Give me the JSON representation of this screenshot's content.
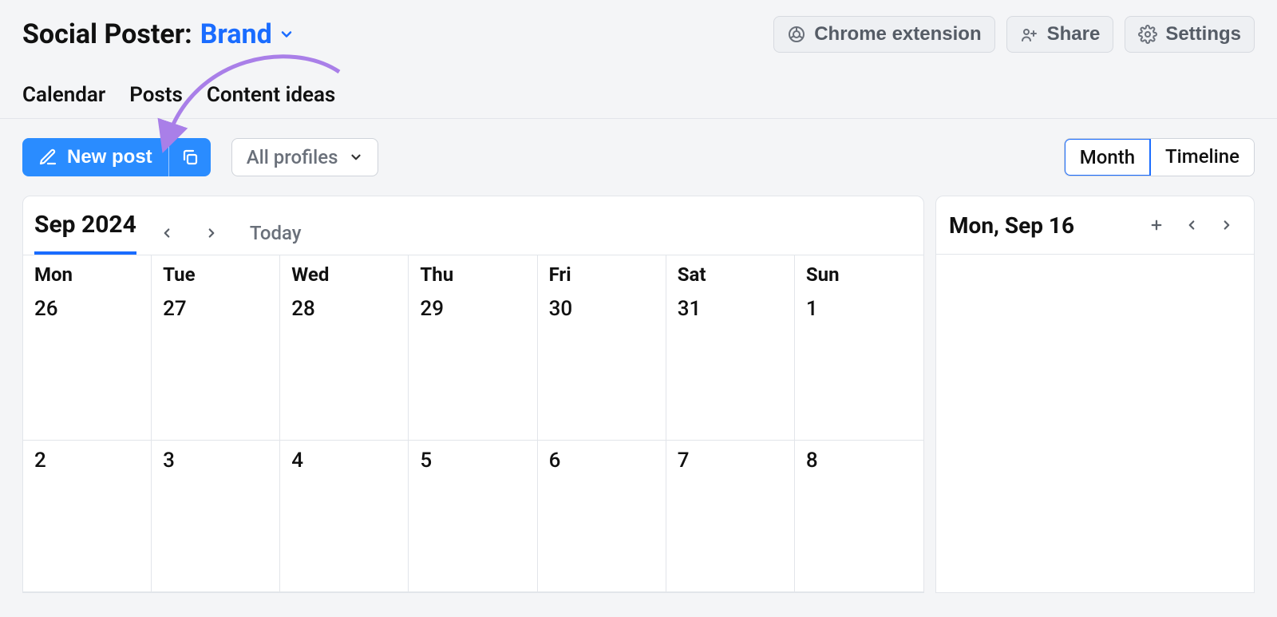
{
  "header": {
    "title_prefix": "Social Poster:",
    "brand_label": "Brand",
    "buttons": {
      "chrome": "Chrome extension",
      "share": "Share",
      "settings": "Settings"
    }
  },
  "tabs": [
    "Calendar",
    "Posts",
    "Content ideas"
  ],
  "toolbar": {
    "new_post": "New post",
    "profiles": "All profiles",
    "views": {
      "month": "Month",
      "timeline": "Timeline"
    }
  },
  "calendar": {
    "month_label": "Sep 2024",
    "today_label": "Today",
    "weekdays": [
      "Mon",
      "Tue",
      "Wed",
      "Thu",
      "Fri",
      "Sat",
      "Sun"
    ],
    "rows": [
      [
        "26",
        "27",
        "28",
        "29",
        "30",
        "31",
        "1"
      ],
      [
        "2",
        "3",
        "4",
        "5",
        "6",
        "7",
        "8"
      ]
    ]
  },
  "side": {
    "selected_label": "Mon, Sep 16"
  }
}
